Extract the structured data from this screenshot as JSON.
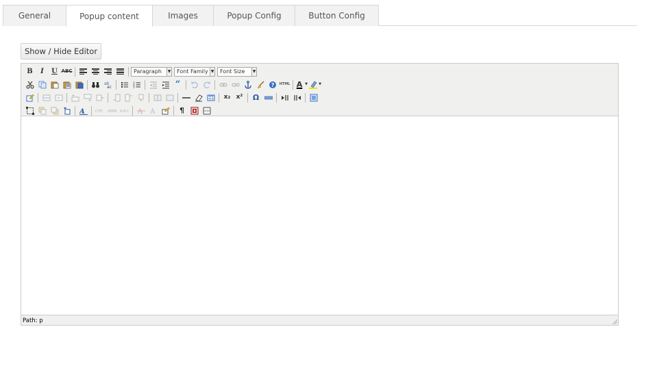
{
  "tabs": [
    {
      "label": "General",
      "active": false
    },
    {
      "label": "Popup content",
      "active": true
    },
    {
      "label": "Images",
      "active": false
    },
    {
      "label": "Popup Config",
      "active": false
    },
    {
      "label": "Button Config",
      "active": false
    }
  ],
  "toggle_button": {
    "label": "Show / Hide Editor"
  },
  "editor": {
    "format_select": "Paragraph",
    "font_family_select": "Font Family",
    "font_size_select": "Font Size",
    "labels": {
      "bold": "B",
      "italic": "I",
      "underline": "U",
      "strikethrough": "ABC",
      "blockquote": "“",
      "html": "HTML",
      "forecolor": "A",
      "subscript": "x₂",
      "superscript": "x²",
      "charmap": "Ω",
      "pilcrow": "¶"
    },
    "path_label": "Path:",
    "path_value": "p"
  }
}
